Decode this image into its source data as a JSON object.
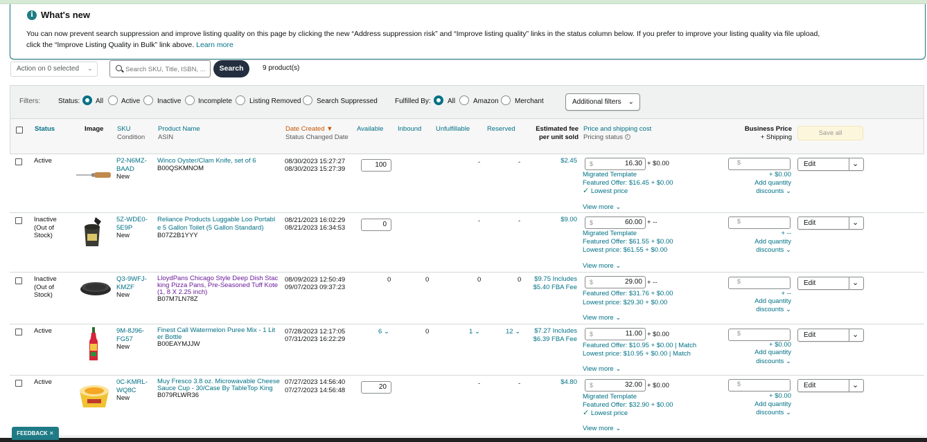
{
  "banner": {
    "title": "What's new",
    "line1": "You can now prevent search suppression and improve listing quality on this page by clicking the new “Address suppression risk” and “Improve listing quality” links in the status column below. If you prefer to improve your listing quality via file upload,",
    "line2": "click the “Improve Listing Quality in Bulk” link above.",
    "learn_more": "Learn more"
  },
  "toolbar": {
    "action_label": "Action on 0 selected",
    "search_placeholder": "Search SKU, Title, ISBN, ...",
    "search_button": "Search",
    "product_count": "9 product(s)"
  },
  "filters": {
    "filters_label": "Filters:",
    "status_label": "Status:",
    "status_options": [
      "All",
      "Active",
      "Inactive",
      "Incomplete",
      "Listing Removed",
      "Search Suppressed"
    ],
    "status_selected": "All",
    "fulfilled_label": "Fulfilled By:",
    "fulfilled_options": [
      "All",
      "Amazon",
      "Merchant"
    ],
    "fulfilled_selected": "All",
    "additional_filters": "Additional filters"
  },
  "columns": {
    "status": "Status",
    "image": "Image",
    "sku": "SKU",
    "condition": "Condition",
    "product_name": "Product Name",
    "asin": "ASIN",
    "date_created": "Date Created",
    "status_changed": "Status Changed Date",
    "available": "Available",
    "inbound": "Inbound",
    "unfulfillable": "Unfulfillable",
    "reserved": "Reserved",
    "fee_line1": "Estimated fee",
    "fee_line2": "per unit sold",
    "price_title": "Price and shipping cost",
    "pricing_status": "Pricing status",
    "business_price": "Business Price",
    "plus_shipping": "+ Shipping",
    "save_all": "Save all"
  },
  "rows": [
    {
      "status": [
        "Active"
      ],
      "sku": [
        "P2-N6MZ-",
        "BAAD"
      ],
      "condition": "New",
      "name": [
        "Winco Oyster/Clam Knife, set of 6"
      ],
      "asin": "B00QSKMNOM",
      "date_created": "08/30/2023 15:27:27",
      "status_changed": "08/30/2023 15:27:39",
      "available": "100",
      "inbound": "-",
      "unfulfillable": "-",
      "reserved": "-",
      "fee": [
        "$2.45"
      ],
      "price": "16.30",
      "shipping": "+ $0.00",
      "pricing_lines": [
        "Migrated Template",
        "Featured Offer: $16.45 + $0.00"
      ],
      "check_line": "Lowest price",
      "view_more": "View more",
      "biz_ship": "+ $0.00",
      "add_qty": "Add quantity",
      "discounts": "discounts",
      "edit": "Edit"
    },
    {
      "status": [
        "Inactive",
        "(Out of",
        "Stock)"
      ],
      "sku": [
        "5Z-WDE0-",
        "5E9P"
      ],
      "condition": "New",
      "name": [
        "Reliance Products Luggable Loo Portabl",
        "e 5 Gallon Toilet (5 Gallon Standard)"
      ],
      "asin": "B07Z2B1YYY",
      "date_created": "08/21/2023 16:02:29",
      "status_changed": "08/21/2023 16:34:53",
      "available": "0",
      "inbound": "-",
      "unfulfillable": "-",
      "reserved": "-",
      "fee": [
        "$9.00"
      ],
      "price": "60.00",
      "shipping": "+ --",
      "pricing_lines": [
        "Migrated Template",
        "Featured Offer: $61.55 + $0.00",
        "Lowest price: $61.55 + $0.00"
      ],
      "check_line": "",
      "view_more": "View more",
      "biz_ship": "+ --",
      "add_qty": "Add quantity",
      "discounts": "discounts",
      "edit": "Edit"
    },
    {
      "status": [
        "Inactive",
        "(Out of",
        "Stock)"
      ],
      "sku": [
        "Q3-9WFJ-",
        "KMZF"
      ],
      "condition": "New",
      "name": [
        "LloydPans Chicago Style Deep Dish Stac",
        "king Pizza Pans, Pre-Seasoned Tuff Kote",
        "(1, 8 X 2.25 inch)"
      ],
      "asin": "B07M7LN78Z",
      "date_created": "08/09/2023 12:50:49",
      "status_changed": "09/07/2023 09:37:23",
      "available": "0",
      "inbound": "0",
      "unfulfillable": "0",
      "reserved": "0",
      "fee": [
        "$9.75 Includes",
        "$5.40 FBA Fee"
      ],
      "price": "29.00",
      "shipping": "+ --",
      "pricing_lines": [
        "Featured Offer: $31.76 + $0.00",
        "Lowest price: $29.30 + $0.00"
      ],
      "check_line": "",
      "view_more": "View more",
      "biz_ship": "+ --",
      "add_qty": "Add quantity",
      "discounts": "discounts",
      "edit": "Edit"
    },
    {
      "status": [
        "Active"
      ],
      "sku": [
        "9M-8J96-",
        "FG57"
      ],
      "condition": "New",
      "name": [
        "Finest Call Watermelon Puree Mix - 1 Lit",
        "er Bottle"
      ],
      "asin": "B00EAYMJJW",
      "date_created": "07/28/2023 12:17:05",
      "status_changed": "07/31/2023 16:22:29",
      "available": "6",
      "inbound": "0",
      "unfulfillable": "1",
      "reserved": "12",
      "fee": [
        "$7.27 Includes",
        "$6.39 FBA Fee"
      ],
      "price": "11.00",
      "shipping": "+ $0.00",
      "pricing_lines": [
        "Featured Offer: $10.95 + $0.00 | Match",
        "Lowest price: $10.95 + $0.00 | Match"
      ],
      "check_line": "",
      "view_more": "View more",
      "biz_ship": "+ $0.00",
      "add_qty": "Add quantity",
      "discounts": "discounts",
      "edit": "Edit"
    },
    {
      "status": [
        "Active"
      ],
      "sku": [
        "0C-KMRL-",
        "WQ8C"
      ],
      "condition": "New",
      "name": [
        "Muy Fresco 3.8 oz. Microwavable Cheese",
        "Sauce Cup - 30/Case By TableTop King"
      ],
      "asin": "B079RLWR36",
      "date_created": "07/27/2023 14:56:40",
      "status_changed": "07/27/2023 14:56:48",
      "available": "20",
      "inbound": "-",
      "unfulfillable": "-",
      "reserved": "-",
      "fee": [
        "$4.80"
      ],
      "price": "32.00",
      "shipping": "+ $0.00",
      "pricing_lines": [
        "Migrated Template",
        "Featured Offer: $32.90 + $0.00"
      ],
      "check_line": "Lowest price",
      "view_more": "View more",
      "biz_ship": "+ $0.00",
      "add_qty": "Add quantity",
      "discounts": "discounts",
      "edit": "Edit"
    }
  ],
  "feedback": "FEEDBACK"
}
